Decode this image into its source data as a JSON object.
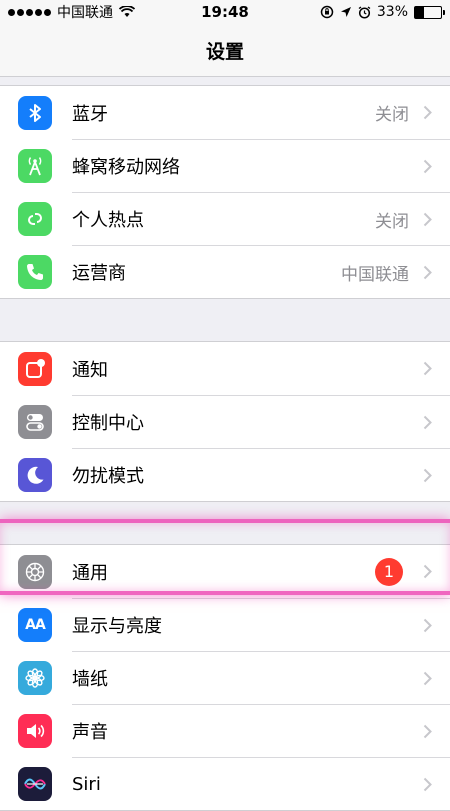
{
  "status_bar": {
    "carrier": "中国联通",
    "time": "19:48",
    "battery_percent": "33%",
    "battery_level": 0.33
  },
  "nav": {
    "title": "设置"
  },
  "groups": [
    {
      "rows": [
        {
          "label": "蓝牙",
          "value": "关闭",
          "icon": "bluetooth-icon",
          "color": "#147efb"
        },
        {
          "label": "蜂窝移动网络",
          "value": "",
          "icon": "cellular-icon",
          "color": "#4cd964"
        },
        {
          "label": "个人热点",
          "value": "关闭",
          "icon": "hotspot-icon",
          "color": "#4cd964"
        },
        {
          "label": "运营商",
          "value": "中国联通",
          "icon": "phone-icon",
          "color": "#4cd964"
        }
      ]
    },
    {
      "rows": [
        {
          "label": "通知",
          "value": "",
          "icon": "notifications-icon",
          "color": "#ff3b30"
        },
        {
          "label": "控制中心",
          "value": "",
          "icon": "control-center-icon",
          "color": "#8e8e93"
        },
        {
          "label": "勿扰模式",
          "value": "",
          "icon": "moon-icon",
          "color": "#5856d6"
        }
      ]
    },
    {
      "rows": [
        {
          "label": "通用",
          "value": "",
          "badge": "1",
          "icon": "gear-icon",
          "color": "#8e8e93"
        },
        {
          "label": "显示与亮度",
          "value": "",
          "icon": "display-icon",
          "color": "#147efb",
          "icon_text": "AA"
        },
        {
          "label": "墙纸",
          "value": "",
          "icon": "wallpaper-icon",
          "color": "#35aadc"
        },
        {
          "label": "声音",
          "value": "",
          "icon": "sound-icon",
          "color": "#ff2d55"
        },
        {
          "label": "Siri",
          "value": "",
          "icon": "siri-icon",
          "color": "#1c1c3a"
        }
      ]
    }
  ]
}
